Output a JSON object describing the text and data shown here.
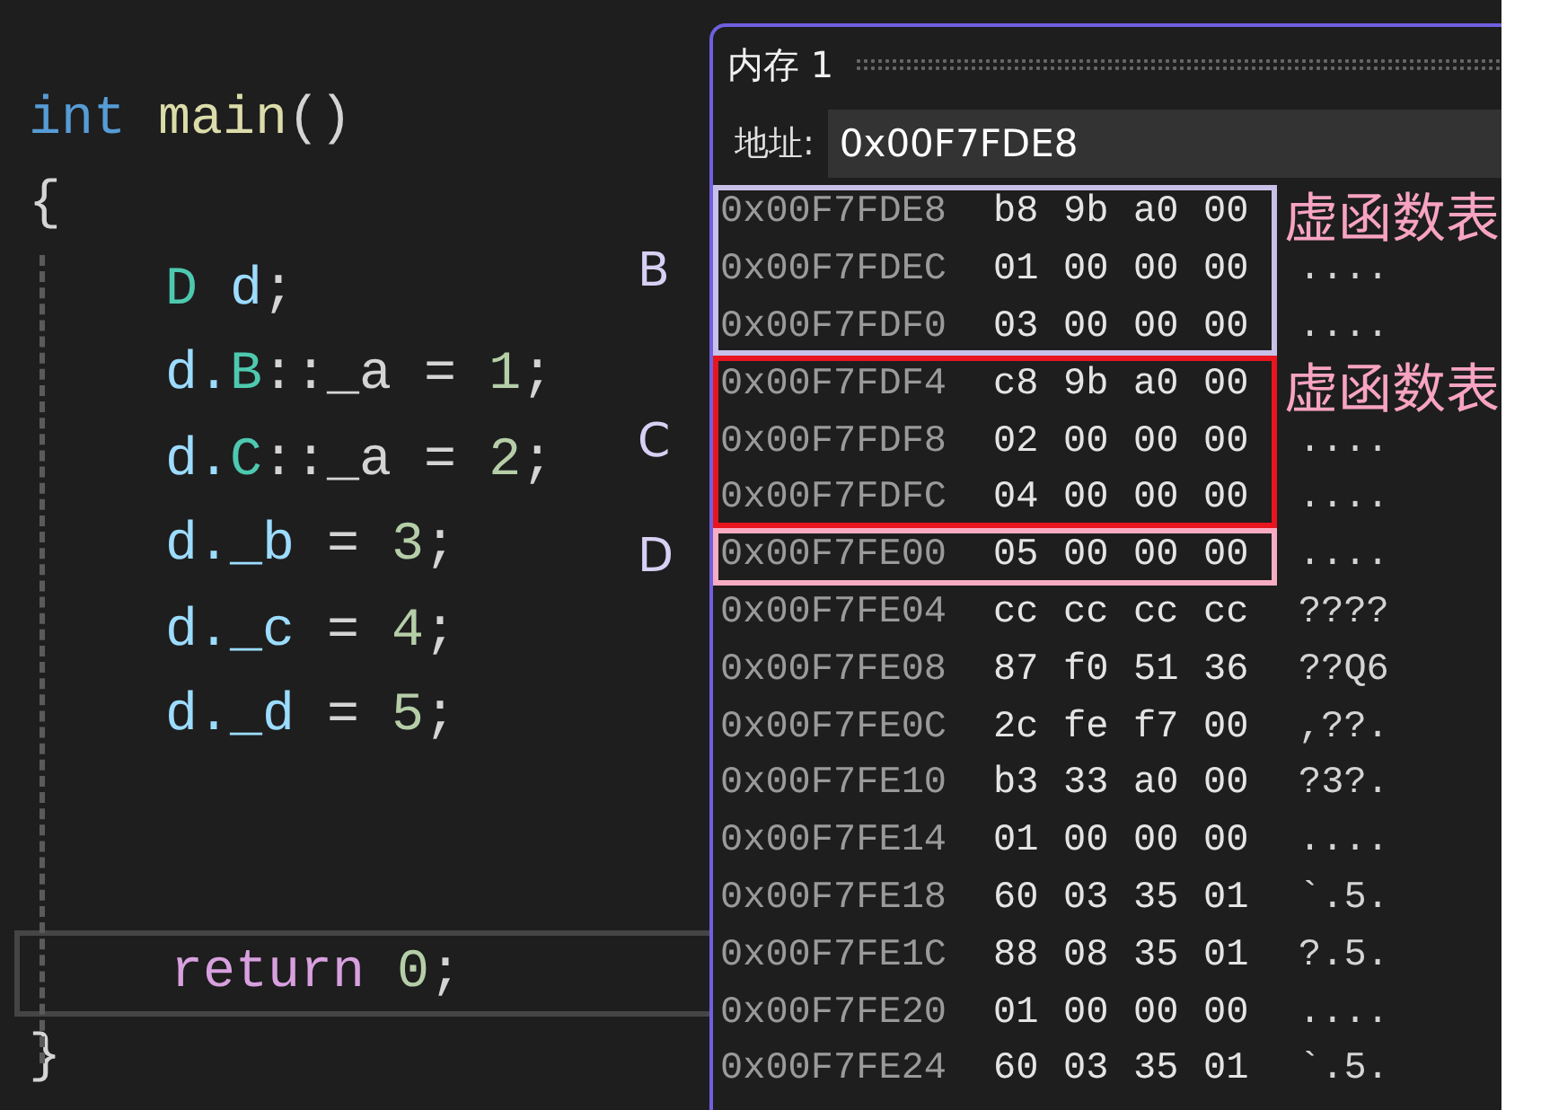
{
  "code": {
    "lines": [
      {
        "current": false,
        "tokens": [
          {
            "text": "int",
            "kind": "keyword"
          },
          {
            "text": " main",
            "kind": "function"
          },
          {
            "text": "()",
            "kind": "punct"
          }
        ]
      },
      {
        "current": false,
        "tokens": [
          {
            "text": "{",
            "kind": "punct"
          }
        ],
        "children": [
          {
            "current": false,
            "tokens": [
              {
                "text": "D",
                "kind": "type"
              },
              {
                "text": " d",
                "kind": "variable"
              },
              {
                "text": ";",
                "kind": "punct"
              }
            ]
          },
          {
            "current": false,
            "tokens": [
              {
                "text": "d.",
                "kind": "variable"
              },
              {
                "text": "B",
                "kind": "type"
              },
              {
                "text": "::_a = ",
                "kind": "punct"
              },
              {
                "text": "1",
                "kind": "number"
              },
              {
                "text": ";",
                "kind": "punct"
              }
            ]
          },
          {
            "current": false,
            "tokens": [
              {
                "text": "d.",
                "kind": "variable"
              },
              {
                "text": "C",
                "kind": "type"
              },
              {
                "text": "::_a = ",
                "kind": "punct"
              },
              {
                "text": "2",
                "kind": "number"
              },
              {
                "text": ";",
                "kind": "punct"
              }
            ]
          },
          {
            "current": false,
            "tokens": [
              {
                "text": "d._b",
                "kind": "variable"
              },
              {
                "text": " = ",
                "kind": "punct"
              },
              {
                "text": "3",
                "kind": "number"
              },
              {
                "text": ";",
                "kind": "punct"
              }
            ]
          },
          {
            "current": false,
            "tokens": [
              {
                "text": "d._c",
                "kind": "variable"
              },
              {
                "text": " = ",
                "kind": "punct"
              },
              {
                "text": "4",
                "kind": "number"
              },
              {
                "text": ";",
                "kind": "punct"
              }
            ]
          },
          {
            "current": false,
            "tokens": [
              {
                "text": "d._d",
                "kind": "variable"
              },
              {
                "text": " = ",
                "kind": "punct"
              },
              {
                "text": "5",
                "kind": "number"
              },
              {
                "text": ";",
                "kind": "punct"
              }
            ]
          },
          {
            "current": false
          },
          {
            "current": false
          },
          {
            "current": true,
            "tokens": [
              {
                "text": "return",
                "kind": "control"
              },
              {
                "text": " 0",
                "kind": "number"
              },
              {
                "text": ";",
                "kind": "punct"
              }
            ]
          }
        ]
      },
      {
        "current": false,
        "tokens": [
          {
            "text": "}",
            "kind": "punct"
          }
        ]
      }
    ]
  },
  "memory": {
    "title": "内存 1",
    "address_label": "地址:",
    "address": "0x00F7FDE8",
    "blocks": [
      {
        "label": "B",
        "color": "#c8c0e8",
        "note": "虚函数表",
        "rows": [
          {
            "address": "0x00F7FDE8",
            "bytes": [
              "b8",
              "9b",
              "a0",
              "00"
            ]
          },
          {
            "address": "0x00F7FDEC",
            "bytes": [
              "01",
              "00",
              "00",
              "00"
            ],
            "ascii": "...."
          },
          {
            "address": "0x00F7FDF0",
            "bytes": [
              "03",
              "00",
              "00",
              "00"
            ],
            "ascii": "...."
          }
        ]
      },
      {
        "label": "C",
        "color": "#e8141e",
        "note": "虚函数表",
        "rows": [
          {
            "address": "0x00F7FDF4",
            "bytes": [
              "c8",
              "9b",
              "a0",
              "00"
            ]
          },
          {
            "address": "0x00F7FDF8",
            "bytes": [
              "02",
              "00",
              "00",
              "00"
            ],
            "ascii": "...."
          },
          {
            "address": "0x00F7FDFC",
            "bytes": [
              "04",
              "00",
              "00",
              "00"
            ],
            "ascii": "...."
          }
        ]
      },
      {
        "label": "D",
        "color": "#f8acc4",
        "rows": [
          {
            "address": "0x00F7FE00",
            "bytes": [
              "05",
              "00",
              "00",
              "00"
            ],
            "ascii": "...."
          }
        ]
      },
      {
        "rows": [
          {
            "address": "0x00F7FE04",
            "bytes": [
              "cc",
              "cc",
              "cc",
              "cc"
            ],
            "ascii": "????"
          },
          {
            "address": "0x00F7FE08",
            "bytes": [
              "87",
              "f0",
              "51",
              "36"
            ],
            "ascii": "??Q6"
          },
          {
            "address": "0x00F7FE0C",
            "bytes": [
              "2c",
              "fe",
              "f7",
              "00"
            ],
            "ascii": ",??."
          },
          {
            "address": "0x00F7FE10",
            "bytes": [
              "b3",
              "33",
              "a0",
              "00"
            ],
            "ascii": "?3?."
          },
          {
            "address": "0x00F7FE14",
            "bytes": [
              "01",
              "00",
              "00",
              "00"
            ],
            "ascii": "...."
          },
          {
            "address": "0x00F7FE18",
            "bytes": [
              "60",
              "03",
              "35",
              "01"
            ],
            "ascii": "`.5."
          },
          {
            "address": "0x00F7FE1C",
            "bytes": [
              "88",
              "08",
              "35",
              "01"
            ],
            "ascii": "?.5."
          },
          {
            "address": "0x00F7FE20",
            "bytes": [
              "01",
              "00",
              "00",
              "00"
            ],
            "ascii": "...."
          },
          {
            "address": "0x00F7FE24",
            "bytes": [
              "60",
              "03",
              "35",
              "01"
            ],
            "ascii": "`.5."
          }
        ]
      }
    ]
  }
}
